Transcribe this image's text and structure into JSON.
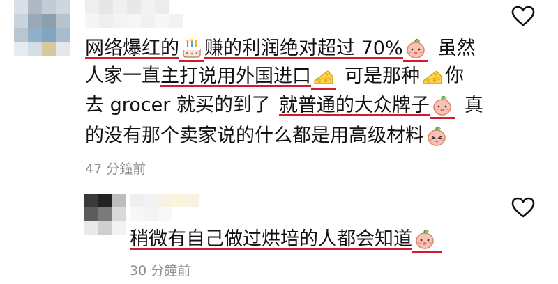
{
  "comments": [
    {
      "lines": [
        {
          "parts": [
            "网络爆红的",
            "赚的利润绝对超过 70%",
            "虽然"
          ]
        },
        {
          "parts": [
            "人家一直",
            "主打说用外国进口",
            "可是那种",
            "你"
          ]
        },
        {
          "parts": [
            "去 grocer 就买的到了",
            "就普通的大众牌子",
            "真"
          ]
        },
        {
          "parts": [
            "的没有那个卖家说的什么都是用高级材料"
          ]
        }
      ],
      "timestamp": "47 分鐘前",
      "emojis": [
        "cake-emoji",
        "peach-face-emoji",
        "cheese-emoji",
        "cheese-emoji",
        "peach-face-emoji",
        "peach-laugh-emoji"
      ]
    },
    {
      "lines": [
        {
          "parts": [
            "稍微有自己做过烘培的人都会知道"
          ]
        }
      ],
      "timestamp": "30 分鐘前",
      "emojis": [
        "peach-face-emoji"
      ]
    }
  ],
  "colors": {
    "underline": "#d21c2c",
    "timestamp": "#8e8e8e"
  },
  "icons": {
    "like": "heart-outline-icon"
  }
}
